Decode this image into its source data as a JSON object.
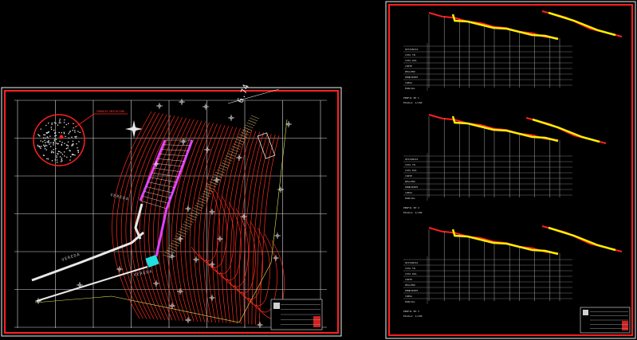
{
  "drawing": {
    "background": "#000000",
    "frame_color": "#ff2020",
    "contour_color": "#ff2a1a",
    "grid_color": "#d8d8d8",
    "path_color": "#e040ff",
    "street_color": "#e8e8e8",
    "profile_yellow": "#ffee00",
    "accent_cyan": "#20e0e0"
  },
  "left_sheet": {
    "location_label": "CROQUIS UBICACION",
    "street_1": "VEREDA",
    "street_2": "VEREDA",
    "street_3": "VEREDA",
    "north_icon": "north-arrow-icon",
    "title_block_icon": "title-block-logo-icon",
    "dimension_text": "6.74"
  },
  "right_sheet": {
    "profiles": [
      {
        "caption": "PERFIL EP 1",
        "scale": "ESCALA: 1/100"
      },
      {
        "caption": "PERFIL EP 2",
        "scale": "ESCALA: 1/100"
      },
      {
        "caption": "PERFIL EP 3",
        "scale": "ESCALA: 1/100"
      }
    ],
    "table_rows": [
      "DISTANCIA",
      "COTA TN",
      "COTA RAS",
      "CORTE",
      "RELLENO",
      "PENDIENTE",
      "CURVA",
      "PARCIAL"
    ],
    "title_block_icon": "title-block-logo-icon"
  }
}
